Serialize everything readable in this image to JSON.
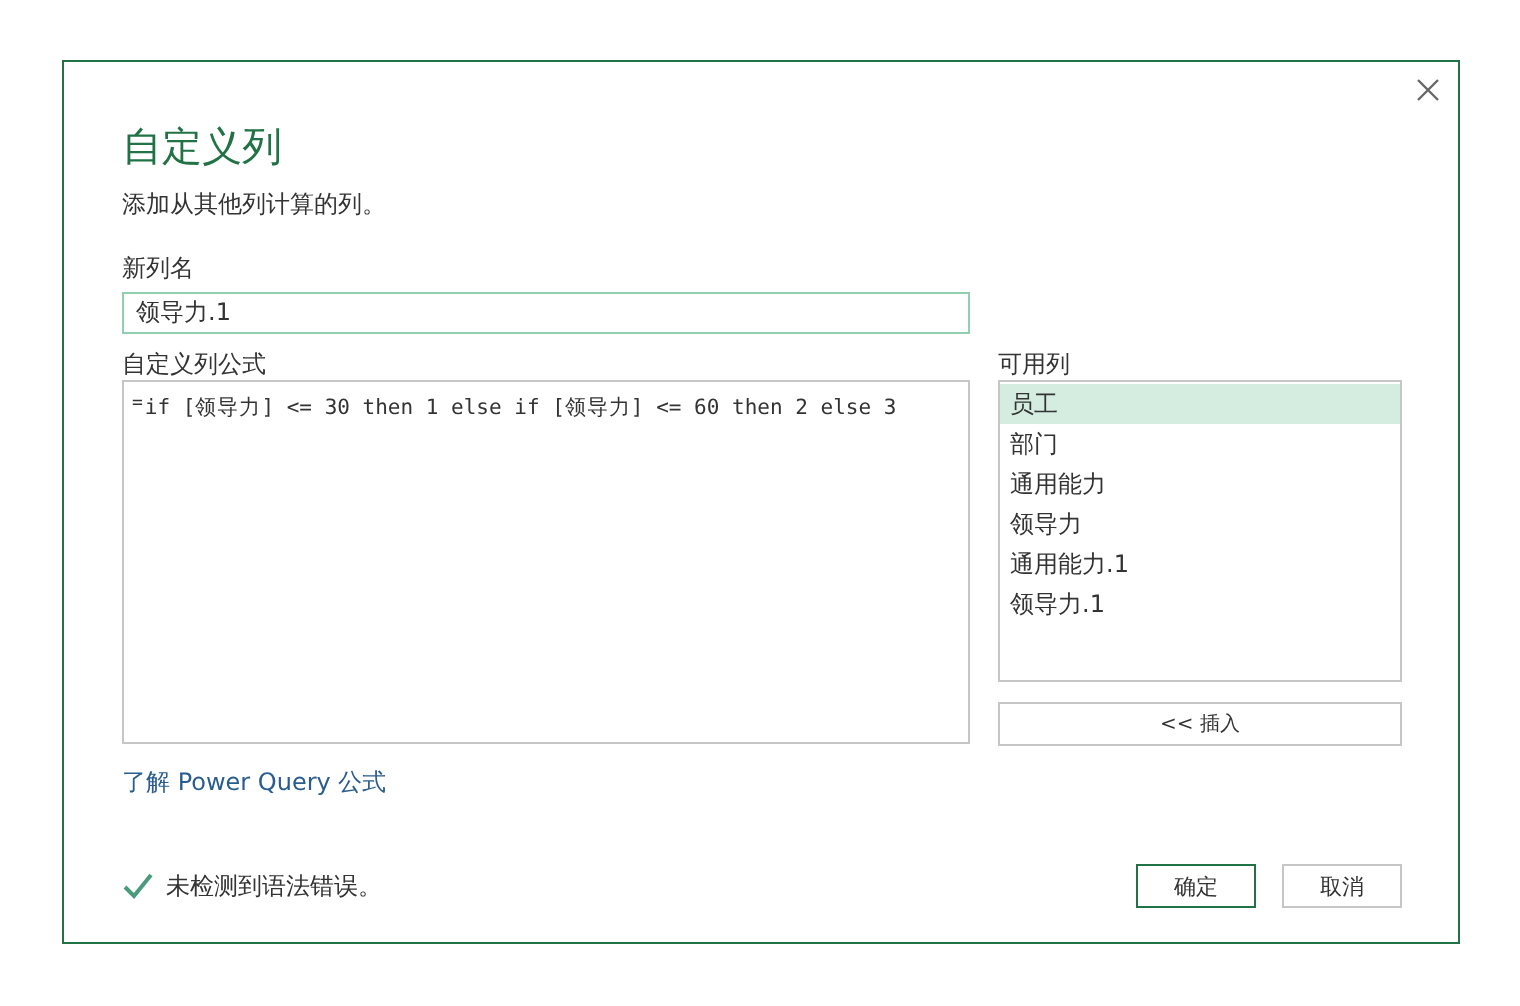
{
  "dialog": {
    "title": "自定义列",
    "subtitle": "添加从其他列计算的列。"
  },
  "new_column_name": {
    "label": "新列名",
    "value": "领导力.1"
  },
  "formula": {
    "label": "自定义列公式",
    "prefix": "=",
    "value": "if [领导力] <= 30 then 1 else if [领导力] <= 60 then 2 else 3"
  },
  "available_columns": {
    "label": "可用列",
    "items": [
      {
        "text": "员工",
        "selected": true
      },
      {
        "text": "部门",
        "selected": false
      },
      {
        "text": "通用能力",
        "selected": false
      },
      {
        "text": "领导力",
        "selected": false
      },
      {
        "text": "通用能力.1",
        "selected": false
      },
      {
        "text": "领导力.1",
        "selected": false
      }
    ]
  },
  "insert_button": "<< 插入",
  "learn_link": "了解 Power Query 公式",
  "status": {
    "kind": "ok",
    "text": "未检测到语法错误。"
  },
  "buttons": [
    {
      "label": "确定",
      "primary": true
    },
    {
      "label": "取消",
      "primary": false
    }
  ]
}
